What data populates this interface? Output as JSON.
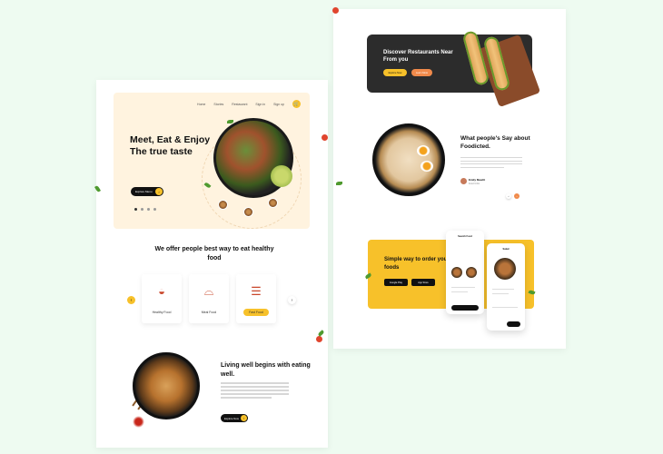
{
  "left": {
    "nav": {
      "items": [
        "Home",
        "Stories",
        "Restaurant",
        "Sign in",
        "Sign up"
      ]
    },
    "hero": {
      "title": "Meet, Eat & Enjoy The true taste",
      "button": "Explore Menu"
    },
    "offer": {
      "title": "We offer people best way to eat healthy food",
      "cards": [
        {
          "label": "Healthy Food",
          "icon": "salad-bowl-icon"
        },
        {
          "label": "Meal Food",
          "icon": "food-cloche-icon"
        },
        {
          "label": "Fast Food",
          "icon": "burger-icon"
        }
      ]
    },
    "living": {
      "title": "Living well begins with eating well.",
      "button": "Explore Now"
    }
  },
  "right": {
    "discover": {
      "title": "Discover Restaurants Near From you",
      "btn_primary": "Explore Now",
      "btn_secondary": "Learn More"
    },
    "testimonial": {
      "title": "What people's Say about Foodicted.",
      "author": "Emily Mewitt",
      "author_sub": "Food Critic"
    },
    "app": {
      "title": "Simple way to order your foods",
      "google_play": "Google Play",
      "app_store": "App Store",
      "phone_title": "Search Food",
      "phone2_title": "Salad"
    }
  },
  "colors": {
    "accent": "#f7c12a",
    "orange": "#f08a4b",
    "dark": "#2c2c2c",
    "background": "#eefbf1"
  }
}
